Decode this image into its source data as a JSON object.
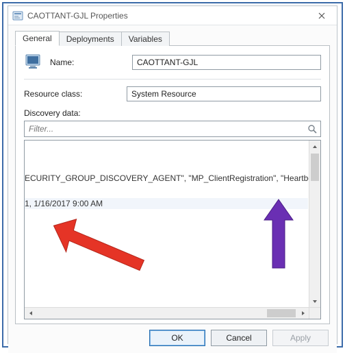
{
  "window": {
    "title": "CAOTTANT-GJL Properties"
  },
  "tabs": [
    {
      "label": "General"
    },
    {
      "label": "Deployments"
    },
    {
      "label": "Variables"
    }
  ],
  "general": {
    "name_label": "Name:",
    "name_value": "CAOTTANT-GJL",
    "resource_class_label": "Resource class:",
    "resource_class_value": "System Resource",
    "discovery_label": "Discovery data:",
    "filter_placeholder": "Filter...",
    "list": {
      "agents_row": "SECURITY_GROUP_DISCOVERY_AGENT\", \"MP_ClientRegistration\", \"Heartbeat Discovery\"",
      "time_row": "1, 1/16/2017 9:00 AM"
    }
  },
  "buttons": {
    "ok": "OK",
    "cancel": "Cancel",
    "apply": "Apply"
  },
  "icons": {
    "app": "properties-icon",
    "close": "close-icon",
    "computer": "computer-icon",
    "search": "search-icon"
  },
  "colors": {
    "frame_blue": "#3a6aa8",
    "arrow_red": "#e53426",
    "arrow_purple": "#6a2fb3"
  }
}
